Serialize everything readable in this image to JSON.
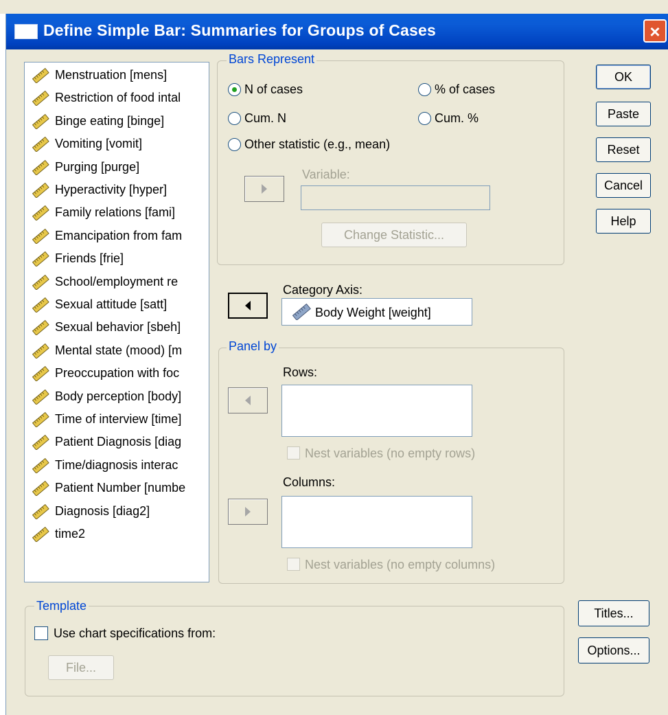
{
  "window": {
    "title": "Define Simple Bar: Summaries for Groups of Cases",
    "close_label": "×",
    "title_icon": "window-icon"
  },
  "variables": [
    "Menstruation [mens]",
    "Restriction of food intal",
    "Binge eating [binge]",
    "Vomiting [vomit]",
    "Purging [purge]",
    "Hyperactivity [hyper]",
    "Family relations [fami]",
    "Emancipation from fam",
    "Friends [frie]",
    "School/employment re",
    "Sexual attitude [satt]",
    "Sexual behavior [sbeh]",
    "Mental state (mood) [m",
    "Preoccupation with foc",
    "Body perception [body]",
    "Time of interview [time]",
    "Patient Diagnosis [diag",
    "Time/diagnosis interac",
    "Patient Number [numbe",
    "Diagnosis [diag2]",
    "time2"
  ],
  "variable_icon": "ruler-icon",
  "bars_represent": {
    "legend": "Bars Represent",
    "n_of_cases": "N of cases",
    "pct_of_cases": "% of cases",
    "cum_n": "Cum. N",
    "cum_pct": "Cum. %",
    "other_statistic": "Other statistic (e.g., mean)",
    "selected": "n_of_cases",
    "variable_label": "Variable:",
    "variable_value": "",
    "change_statistic": "Change Statistic..."
  },
  "category_axis": {
    "label": "Category Axis:",
    "value": "Body Weight [weight]"
  },
  "panel_by": {
    "legend": "Panel by",
    "rows_label": "Rows:",
    "nest_rows": "Nest variables (no empty rows)",
    "columns_label": "Columns:",
    "nest_columns": "Nest variables (no empty columns)"
  },
  "template": {
    "legend": "Template",
    "use_chart_spec": "Use chart specifications from:",
    "file_button": "File..."
  },
  "buttons": {
    "ok": "OK",
    "paste": "Paste",
    "reset": "Reset",
    "cancel": "Cancel",
    "help": "Help",
    "titles": "Titles...",
    "options": "Options..."
  },
  "colors": {
    "titlebar": "#0054e3",
    "dialog_bg": "#ECE9D8",
    "group_legend": "#0046d5",
    "radio_selected": "#21a121",
    "close_button": "#e0562f"
  }
}
